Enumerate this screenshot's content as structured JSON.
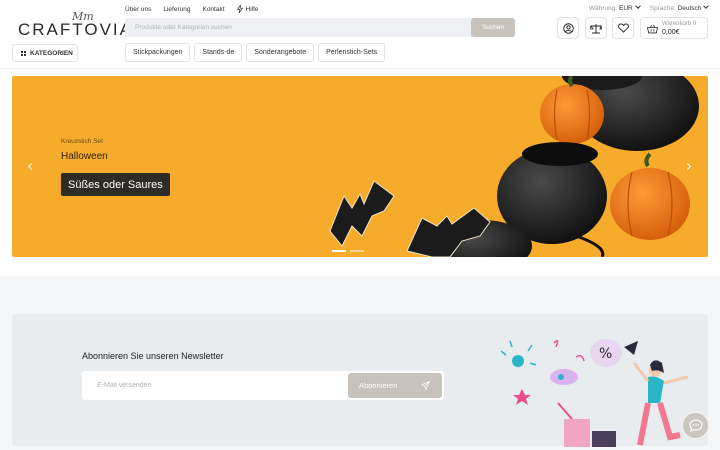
{
  "brand": {
    "logo_text": "CRAFTOVIA",
    "logo_mark": "Mm"
  },
  "header": {
    "categories_label": "KATEGORIEN",
    "top_links": [
      "Über uns",
      "Lieferung",
      "Kontakt"
    ],
    "help_label": "Hilfe",
    "search": {
      "placeholder": "Produkte oder Kategorien suchen",
      "button": "Suchen"
    },
    "currency": {
      "label": "Währung:",
      "value": "EUR"
    },
    "language": {
      "label": "Sprache:",
      "value": "Deutsch"
    },
    "icons": [
      "user-icon",
      "scale-icon",
      "heart-icon"
    ],
    "cart": {
      "label": "Warenkorb 0",
      "total": "0,00€"
    },
    "category_pills": [
      "Stickpackungen",
      "Stands-de",
      "Sonderangebote",
      "Perlenstich-Sets"
    ]
  },
  "hero": {
    "subtitle": "Kreuzstich Set",
    "title": "Halloween",
    "cta": "Süßes oder Saures",
    "slide_count": 2,
    "active_slide": 1
  },
  "newsletter": {
    "title": "Abonnieren Sie unseren Newsletter",
    "placeholder": "E-Mail versenden",
    "button": "Abonnieren"
  },
  "colors": {
    "banner_bg": "#f7ab2a",
    "button_muted": "#c8c2bc",
    "newsletter_bg": "#e8ecef",
    "cta_bg": "#2f2b27"
  }
}
